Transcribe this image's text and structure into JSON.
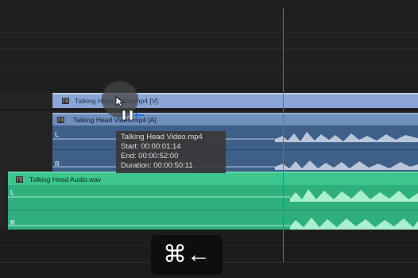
{
  "timeline": {
    "video_track": {
      "clip_label": "Talking Head Video.mp4 [V]"
    },
    "linked_audio_track": {
      "clip_label": "Talking Head Video.mp4 [A]",
      "left_channel": "L",
      "right_channel": "R"
    },
    "audio_track": {
      "clip_label": "Talking Head Audio.wav",
      "left_channel": "L",
      "right_channel": "R"
    }
  },
  "tooltip": {
    "title": "Talking Head Video.mp4",
    "start": "Start: 00:00:01:14",
    "end": "End: 00:00:52:00",
    "duration": "Duration: 00:00:50:11"
  },
  "shortcut": {
    "keys": "⌘←"
  },
  "icons": [
    "fx-badge-icon",
    "ripple-trim-cursor-icon"
  ],
  "colors": {
    "video_clip": "#8aa6d6",
    "linked_audio_clip": "#3d5f88",
    "audio_clip": "#2fae7e",
    "playhead": "#3c78d8"
  }
}
